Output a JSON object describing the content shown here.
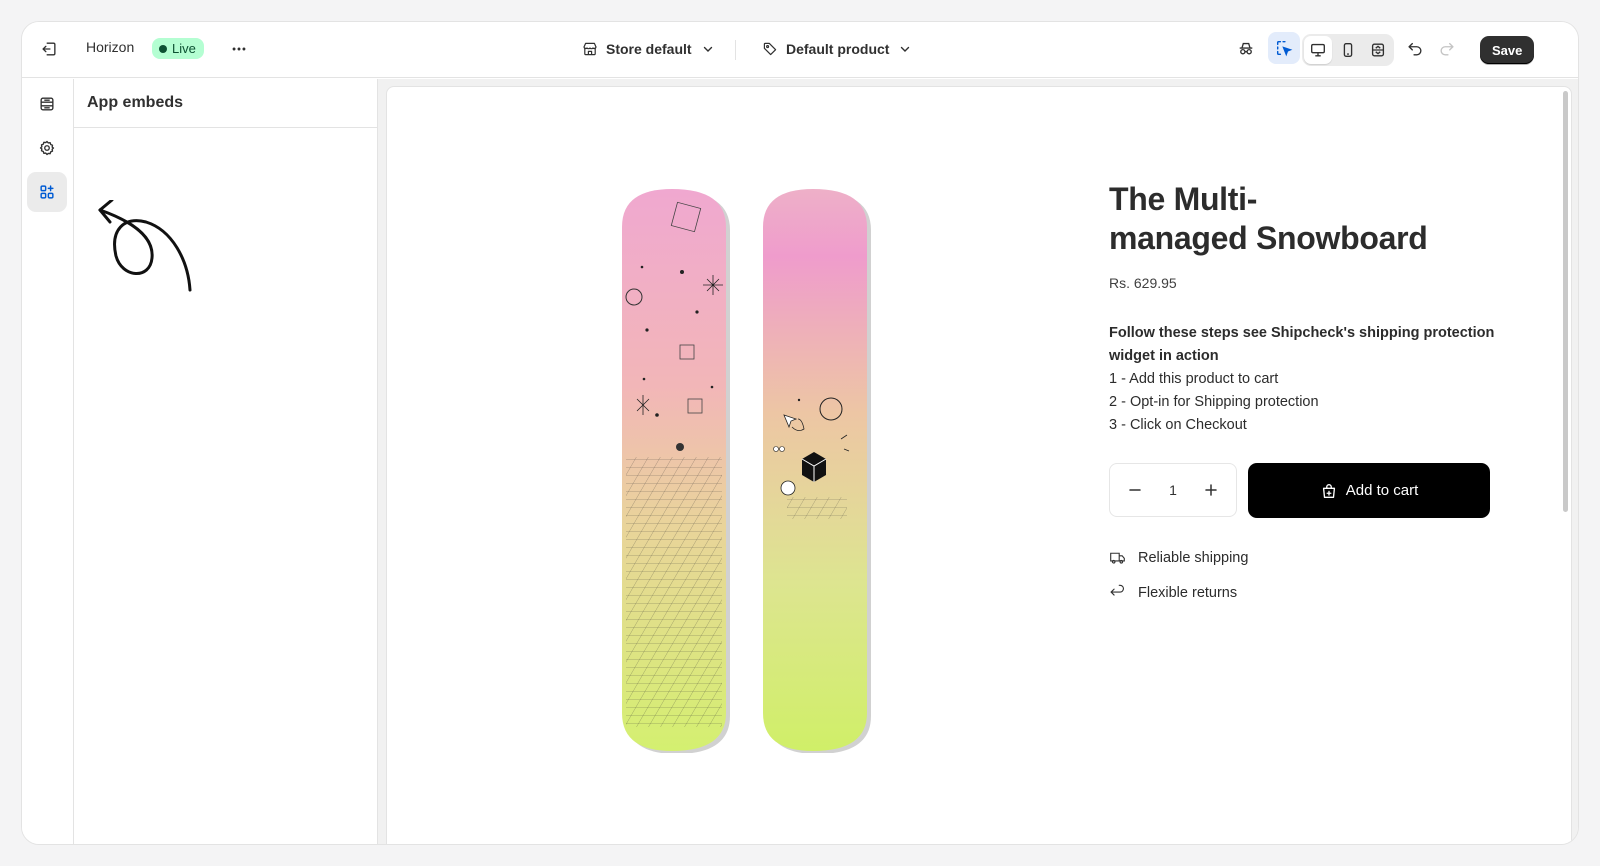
{
  "topbar": {
    "theme_name": "Horizon",
    "live_badge": "Live",
    "store_selector": "Store default",
    "template_selector": "Default product",
    "save_label": "Save"
  },
  "rail": {
    "items": [
      "sections-icon",
      "settings-icon",
      "app-embeds-icon"
    ],
    "active": "app-embeds-icon"
  },
  "panel": {
    "title": "App embeds"
  },
  "product": {
    "title_line1": "The Multi-",
    "title_line2": "managed Snowboard",
    "price": "Rs. 629.95",
    "description_bold": "Follow these steps see Shipcheck's shipping protection widget in action",
    "steps": [
      "1 - Add this product to cart",
      "2 - Opt-in for Shipping protection",
      "3 - Click on Checkout"
    ],
    "quantity": "1",
    "add_to_cart": "Add to cart",
    "perks": [
      "Reliable shipping",
      "Flexible returns"
    ]
  },
  "colors": {
    "live_badge_bg": "#b4fed2",
    "live_badge_text": "#0c5132",
    "accent_blue": "#005bd3",
    "save_bg": "#303030",
    "add_to_cart_bg": "#000000",
    "board_top": "#f0a8d0",
    "board_bottom": "#d4f070"
  }
}
